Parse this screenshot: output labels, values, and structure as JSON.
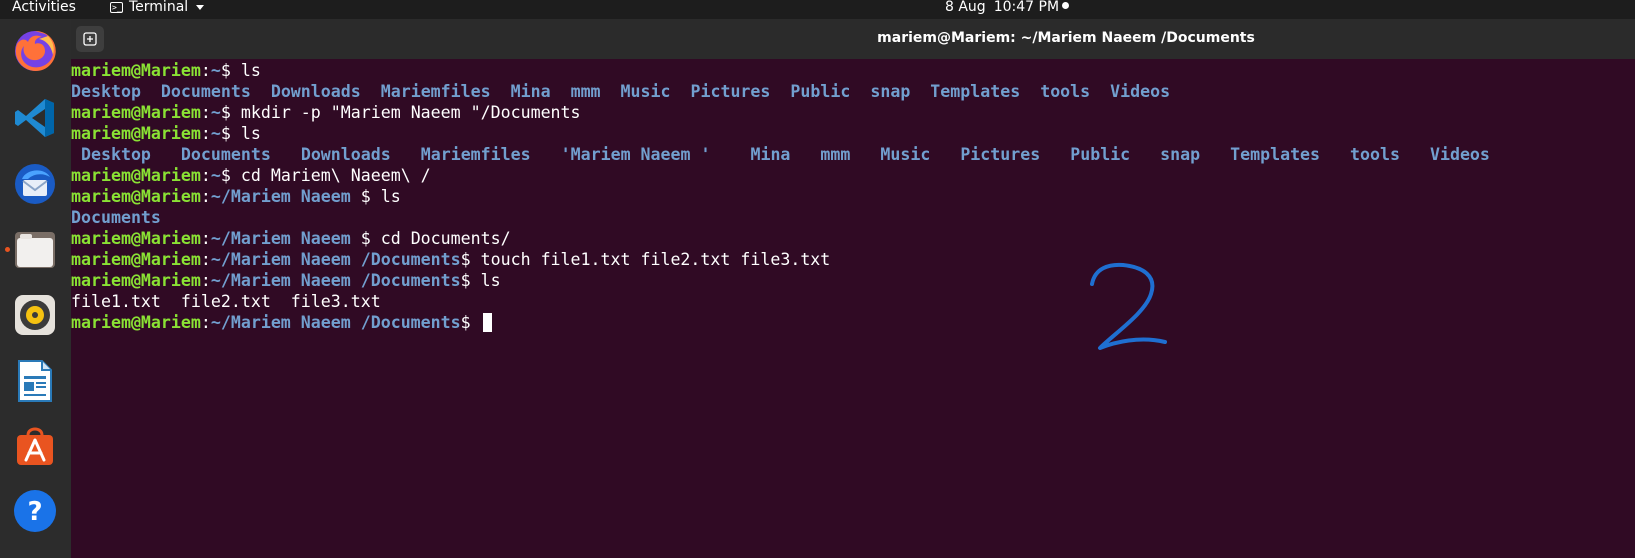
{
  "topbar": {
    "activities": "Activities",
    "app_name": "Terminal",
    "date": "8 Aug",
    "time": "10:47 PM"
  },
  "dock": {
    "items": [
      "firefox-icon",
      "vscode-icon",
      "thunderbird-icon",
      "files-icon",
      "rhythmbox-icon",
      "libreoffice-writer-icon",
      "ubuntu-software-icon",
      "help-icon"
    ]
  },
  "window": {
    "title": "mariem@Mariem: ~/Mariem Naeem /Documents"
  },
  "terminal": {
    "user_host": "mariem@Mariem",
    "lines": [
      {
        "path": "~",
        "cmd": "ls"
      },
      {
        "out_dirs": [
          "Desktop",
          "Documents",
          "Downloads",
          "Mariemfiles",
          "Mina",
          "mmm",
          "Music",
          "Pictures",
          "Public",
          "snap",
          "Templates",
          "tools",
          "Videos"
        ]
      },
      {
        "path": "~",
        "cmd": "mkdir -p \"Mariem Naeem \"/Documents"
      },
      {
        "path": "~",
        "cmd": "ls"
      },
      {
        "out_dirs2": [
          " Desktop",
          "Documents",
          "Downloads",
          "Mariemfiles",
          "'Mariem Naeem '",
          " Mina",
          "mmm",
          "Music",
          "Pictures",
          "Public",
          "snap",
          "Templates",
          "tools",
          "Videos"
        ]
      },
      {
        "path": "~",
        "cmd": "cd Mariem\\ Naeem\\ /"
      },
      {
        "path": "~/Mariem Naeem ",
        "cmd": "ls"
      },
      {
        "out_dirs3": [
          "Documents"
        ]
      },
      {
        "path": "~/Mariem Naeem ",
        "cmd": "cd Documents/"
      },
      {
        "path": "~/Mariem Naeem /Documents",
        "cmd": "touch file1.txt file2.txt file3.txt"
      },
      {
        "path": "~/Mariem Naeem /Documents",
        "cmd": "ls"
      },
      {
        "out_files": "file1.txt  file2.txt  file3.txt"
      },
      {
        "path": "~/Mariem Naeem /Documents",
        "cmd": ""
      }
    ]
  },
  "annotation": {
    "color": "#1f6fd1"
  },
  "colors": {
    "terminal_bg": "#300a24",
    "user_green": "#8ae234",
    "path_blue": "#729fcf",
    "accent_orange": "#e95420"
  }
}
